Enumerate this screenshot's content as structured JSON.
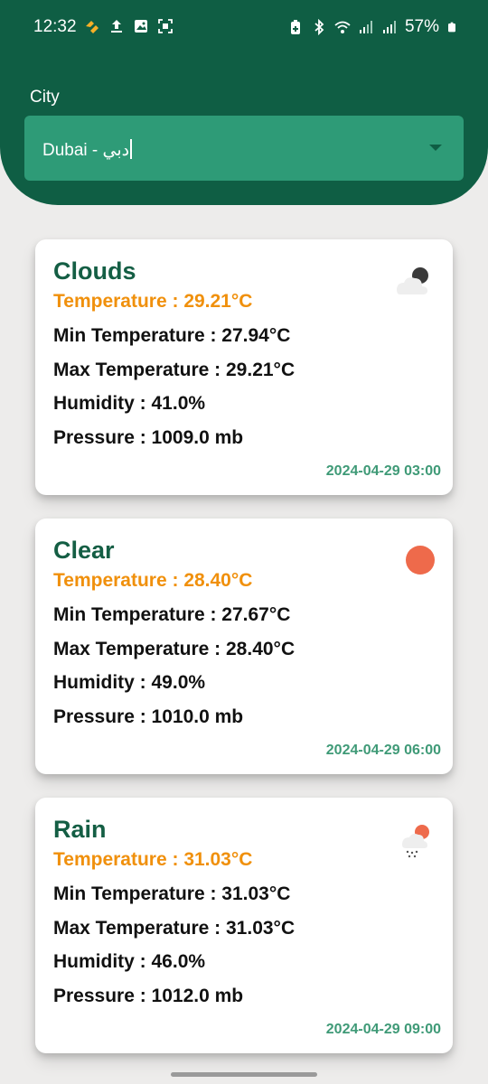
{
  "status_bar": {
    "time": "12:32",
    "battery": "57%",
    "icons": [
      "notification-icon",
      "upload-icon",
      "gallery-icon",
      "screenshot-icon",
      "battery-saver-icon",
      "bluetooth-icon",
      "wifi-icon",
      "signal-icon",
      "signal-icon",
      "battery-icon"
    ]
  },
  "city": {
    "label": "City",
    "selected": "Dubai - دبي"
  },
  "colors": {
    "primary": "#0f5e44",
    "select_bg": "#2e9b77",
    "temperature": "#f0900c",
    "timestamp": "#3f9a77",
    "sun": "#ee6a4b"
  },
  "forecasts": [
    {
      "condition": "Clouds",
      "icon": "cloud-night-icon",
      "temperature": "Temperature : 29.21°C",
      "min_temperature": "Min Temperature : 27.94°C",
      "max_temperature": "Max Temperature : 29.21°C",
      "humidity": "Humidity : 41.0%",
      "pressure": "Pressure : 1009.0 mb",
      "datetime": "2024-04-29 03:00"
    },
    {
      "condition": "Clear",
      "icon": "sun-icon",
      "temperature": "Temperature : 28.40°C",
      "min_temperature": "Min Temperature : 27.67°C",
      "max_temperature": "Max Temperature : 28.40°C",
      "humidity": "Humidity : 49.0%",
      "pressure": "Pressure : 1010.0 mb",
      "datetime": "2024-04-29 06:00"
    },
    {
      "condition": "Rain",
      "icon": "rain-icon",
      "temperature": "Temperature : 31.03°C",
      "min_temperature": "Min Temperature : 31.03°C",
      "max_temperature": "Max Temperature : 31.03°C",
      "humidity": "Humidity : 46.0%",
      "pressure": "Pressure : 1012.0 mb",
      "datetime": "2024-04-29 09:00"
    }
  ]
}
